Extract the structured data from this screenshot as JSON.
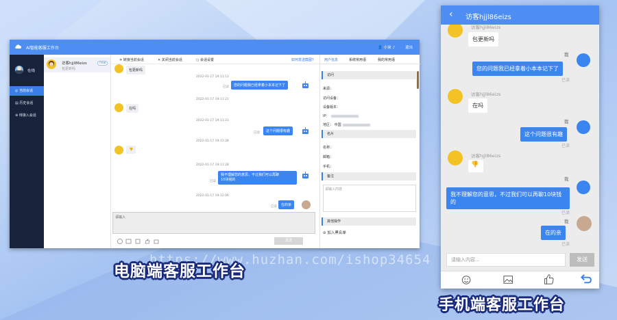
{
  "desktop": {
    "app_title": "AI智能客服工作台",
    "user_name": "小米",
    "exit_label": "退出",
    "status": "在线",
    "nav": [
      "当前会话",
      "历史会话",
      "待接入会话"
    ],
    "conversation": {
      "name": "访客hjjl86eizs",
      "sub": "包更新吗",
      "badge": "new"
    },
    "toolbar": [
      "转接当前会话",
      "关闭当前会话",
      "会话设置"
    ],
    "history_link": "如何发送截图？",
    "messages": {
      "m1": "包更新吗",
      "t1": "2022-01-17 19:11:13",
      "m2": "您的问题我已经拿着小本本记下了",
      "t2": "2022-01-17 19:11:21",
      "m3": "在吗",
      "t3": "2022-01-17 19:11:21",
      "m4": "这个问题很有趣",
      "t4": "2022-01-17 19:11:28",
      "t5": "2022-01-17 19:11:28",
      "m5a": "我不理解您的意思，不过我们可以再聊",
      "m5b": "10块钱的",
      "t6": "2022-01-17 19:12:06",
      "m6": "在的亲",
      "read": "已读"
    },
    "input_placeholder": "请输入",
    "send_label": "发送",
    "info": {
      "tabs": [
        "用户信息",
        "系统常用语",
        "我的常用语"
      ],
      "visit_title": "访问",
      "fields": [
        "来源：",
        "访问设备：",
        "设备版本：",
        "IP：",
        "地区： 中国"
      ],
      "card_title": "名片",
      "card_fields": [
        "名称：",
        "邮箱：",
        "手机："
      ],
      "note_title": "备注",
      "note_placeholder": "请输入内容",
      "other_title": "其他操作",
      "blacklist": "加入黑名单"
    }
  },
  "phone": {
    "title": "访客hjjl86eizs",
    "visitor": "访客hjjl86eizs",
    "me": "我",
    "read": "已读",
    "m1": "包更新吗",
    "m2": "您的问题我已经拿着小本本记下了",
    "m3": "在吗",
    "m4": "这个问题很有趣",
    "m5": "我不理解您的意思，不过我们可以再聊10块钱的",
    "m6": "在的亲",
    "input_placeholder": "请输入内容...",
    "send_label": "发送"
  },
  "captions": {
    "pc": "电脑端客服工作台",
    "mobile": "手机端客服工作台",
    "watermark": "https://www.huzhan.com/ishop34654"
  },
  "colors": {
    "accent": "#4e8ef2",
    "nav_bg": "#17233a",
    "bubble_out": "#3a85f0",
    "caption_outline": "#1a2a7a"
  }
}
